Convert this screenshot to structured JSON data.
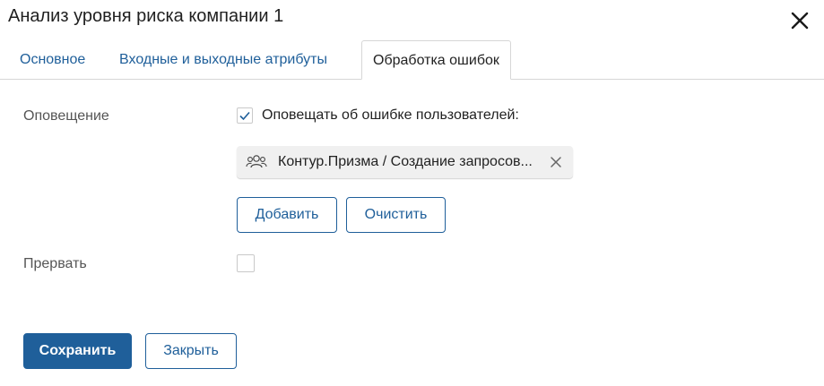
{
  "dialog": {
    "title": "Анализ уровня риска компании 1",
    "close_icon": "close-icon"
  },
  "tabs": [
    {
      "label": "Основное",
      "active": false
    },
    {
      "label": "Входные и выходные атрибуты",
      "active": false
    },
    {
      "label": "Обработка ошибок",
      "active": true
    }
  ],
  "form": {
    "notify": {
      "label": "Оповещение",
      "checkbox_label": "Оповещать об ошибке пользователей:",
      "checked": true,
      "chip": {
        "text": "Контур.Призма / Создание запросов...",
        "icon": "users-group-icon"
      },
      "add_label": "Добавить",
      "clear_label": "Очистить"
    },
    "abort": {
      "label": "Прервать",
      "checked": false
    }
  },
  "footer": {
    "save_label": "Сохранить",
    "close_label": "Закрыть"
  },
  "colors": {
    "accent": "#1f5f9a",
    "label_gray": "#555555",
    "border": "#d6d6d6",
    "chip_bg": "#f0f0f0"
  }
}
